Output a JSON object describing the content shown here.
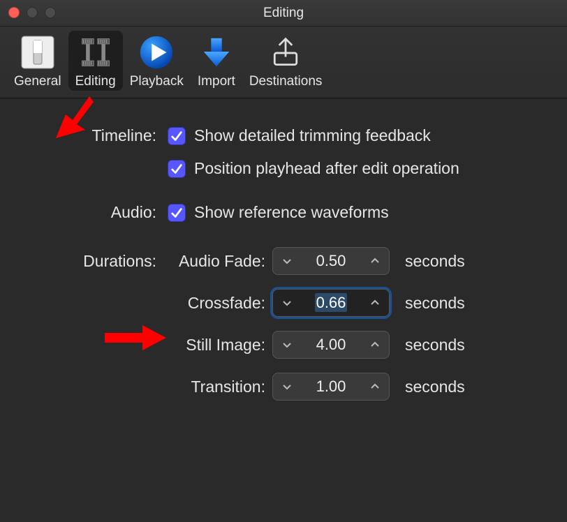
{
  "window": {
    "title": "Editing"
  },
  "toolbar": {
    "items": [
      {
        "label": "General"
      },
      {
        "label": "Editing"
      },
      {
        "label": "Playback"
      },
      {
        "label": "Import"
      },
      {
        "label": "Destinations"
      }
    ]
  },
  "timeline": {
    "label": "Timeline:",
    "opt1": "Show detailed trimming feedback",
    "opt2": "Position playhead after edit operation"
  },
  "audio": {
    "label": "Audio:",
    "opt1": "Show reference waveforms"
  },
  "durations": {
    "label": "Durations:",
    "audioFade": {
      "label": "Audio Fade:",
      "value": "0.50",
      "unit": "seconds"
    },
    "crossfade": {
      "label": "Crossfade:",
      "value": "0.66",
      "unit": "seconds"
    },
    "stillImage": {
      "label": "Still Image:",
      "value": "4.00",
      "unit": "seconds"
    },
    "transition": {
      "label": "Transition:",
      "value": "1.00",
      "unit": "seconds"
    }
  }
}
